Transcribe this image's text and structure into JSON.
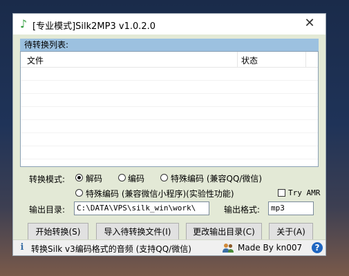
{
  "window": {
    "title": "[专业模式]Silk2MP3 v1.0.2.0",
    "close_glyph": "✕"
  },
  "list": {
    "group_title": "待转换列表:",
    "columns": [
      "文件",
      "状态"
    ]
  },
  "mode": {
    "label": "转换模式:",
    "options": [
      "解码",
      "编码",
      "特殊编码 (兼容QQ/微信)",
      "特殊编码 (兼容微信小程序)(实验性功能)"
    ],
    "selected": "解码",
    "try_amr_label": "Try AMR",
    "try_amr_checked": false
  },
  "output": {
    "dir_label": "输出目录:",
    "dir_value": "C:\\DATA\\VPS\\silk_win\\work\\",
    "format_label": "输出格式:",
    "format_value": "mp3"
  },
  "buttons": {
    "start": "开始转换(S)",
    "import": "导入待转换文件(I)",
    "change_dir": "更改输出目录(C)",
    "about": "关于(A)"
  },
  "status": {
    "text": "转换Silk v3编码格式的音频 (支持QQ/微信)",
    "author": "Made By kn007",
    "help_glyph": "?"
  },
  "icons": {
    "app": "music-note-icon",
    "info": "info-icon",
    "users": "users-icon",
    "help": "help-icon"
  }
}
